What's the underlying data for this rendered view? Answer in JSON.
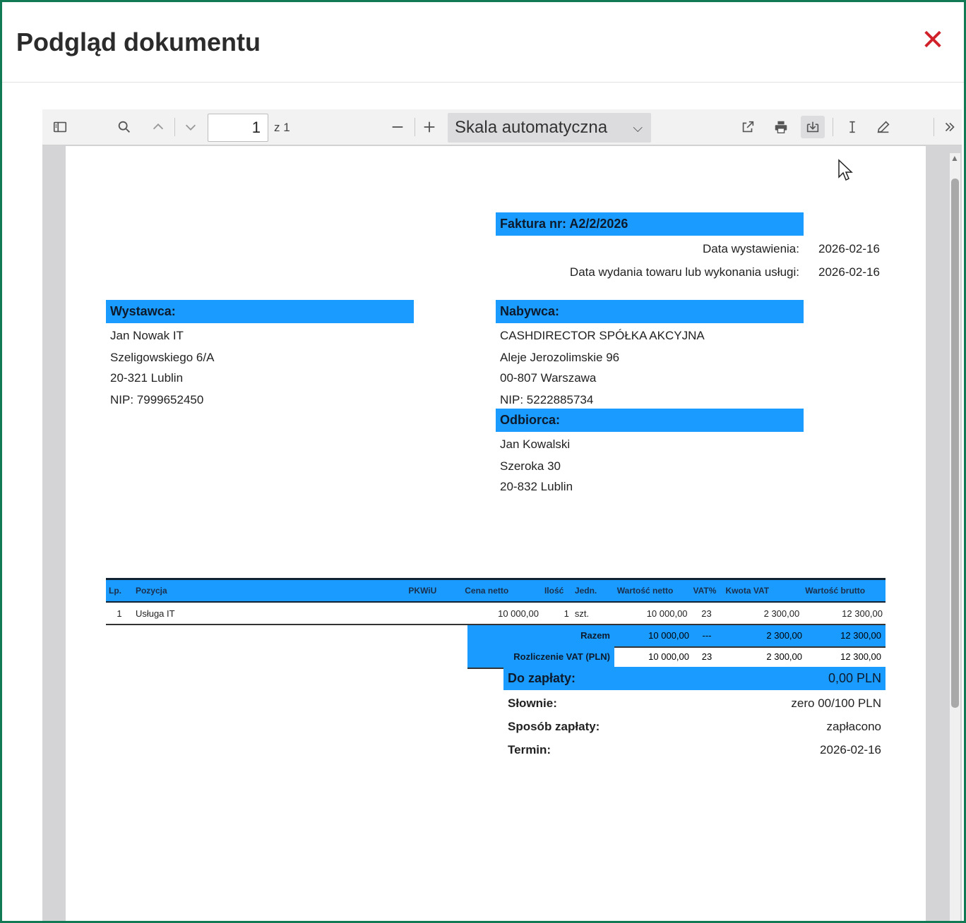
{
  "modal": {
    "title": "Podgląd dokumentu",
    "close_icon": "close-icon"
  },
  "toolbar": {
    "page_number": "1",
    "page_of": "z 1",
    "scale": "Skala automatyczna"
  },
  "invoice": {
    "number_label": "Faktura nr: A2/2/2026",
    "issue_date_label": "Data wystawienia:",
    "issue_date": "2026-02-16",
    "delivery_date_label": "Data wydania towaru lub wykonania usługi:",
    "delivery_date": "2026-02-16",
    "seller": {
      "header": "Wystawca:",
      "name": "Jan Nowak IT",
      "street": "Szeligowskiego 6/A",
      "city": "20-321 Lublin",
      "nip": "NIP: 7999652450"
    },
    "buyer": {
      "header": "Nabywca:",
      "name": "CASHDIRECTOR SPÓŁKA AKCYJNA",
      "street": "Aleje Jerozolimskie 96",
      "city": "00-807 Warszawa",
      "nip": "NIP: 5222885734"
    },
    "recipient": {
      "header": "Odbiorca:",
      "name": "Jan Kowalski",
      "street": "Szeroka 30",
      "city": "20-832 Lublin"
    },
    "table": {
      "headers": [
        "Lp.",
        "Pozycja",
        "PKWiU",
        "Cena netto",
        "Ilość",
        "Jedn.",
        "Wartość netto",
        "VAT%",
        "Kwota VAT",
        "Wartość brutto"
      ],
      "rows": [
        [
          "1",
          "Usługa IT",
          "",
          "10 000,00",
          "1",
          "szt.",
          "10 000,00",
          "23",
          "2 300,00",
          "12 300,00"
        ]
      ],
      "total": {
        "label": "Razem",
        "netto": "10 000,00",
        "vat_pct": "---",
        "vat": "2 300,00",
        "brutto": "12 300,00"
      },
      "vat_settlement": {
        "label": "Rozliczenie VAT (PLN)",
        "netto": "10 000,00",
        "vat_pct": "23",
        "vat": "2 300,00",
        "brutto": "12 300,00"
      }
    },
    "payment": {
      "due_label": "Do zapłaty:",
      "due_value": "0,00 PLN",
      "words_label": "Słownie:",
      "words_value": "zero 00/100 PLN",
      "method_label": "Sposób zapłaty:",
      "method_value": "zapłacono",
      "term_label": "Termin:",
      "term_value": "2026-02-16"
    }
  }
}
